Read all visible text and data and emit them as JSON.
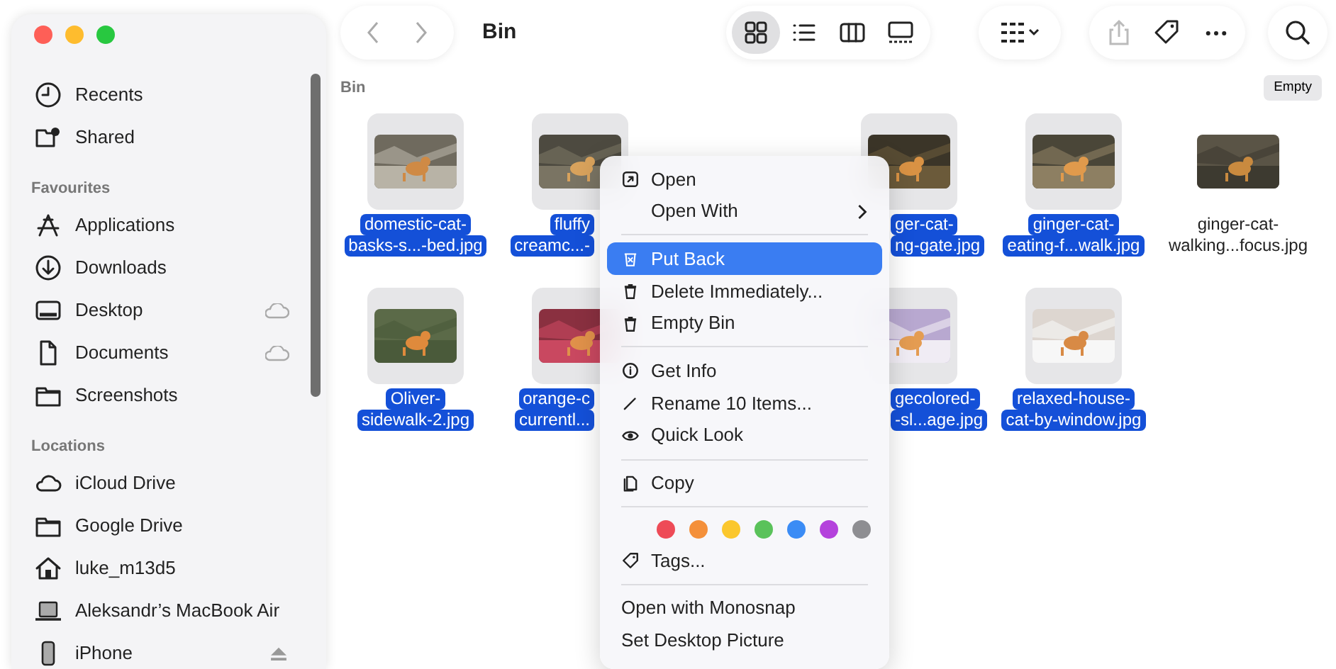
{
  "window": {
    "title": "Bin"
  },
  "sidebar": {
    "sections": [
      {
        "items": [
          {
            "label": "Recents"
          },
          {
            "label": "Shared"
          }
        ]
      },
      {
        "title": "Favourites",
        "items": [
          {
            "label": "Applications"
          },
          {
            "label": "Downloads"
          },
          {
            "label": "Desktop",
            "cloud": true
          },
          {
            "label": "Documents",
            "cloud": true
          },
          {
            "label": "Screenshots"
          }
        ]
      },
      {
        "title": "Locations",
        "items": [
          {
            "label": "iCloud Drive"
          },
          {
            "label": "Google Drive"
          },
          {
            "label": "luke_m13d5"
          },
          {
            "label": "Aleksandr’s MacBook Air"
          },
          {
            "label": "iPhone",
            "eject": true
          }
        ]
      }
    ]
  },
  "toolbar": {
    "views": [
      {
        "selected": true
      },
      {
        "selected": false
      },
      {
        "selected": false
      },
      {
        "selected": false
      }
    ]
  },
  "path_label": "Bin",
  "empty_button": "Empty",
  "files": [
    {
      "kind": "full",
      "name_lines": [
        "domestic-cat-",
        "basks-s...-bed.jpg"
      ],
      "selected": true
    },
    {
      "kind": "cut-right",
      "name_lines": [
        "fluffy",
        "creamc...-"
      ],
      "selected": true
    },
    {
      "kind": "cut-left",
      "name_lines": [
        "ger-cat-",
        "ng-gate.jpg"
      ],
      "selected": true
    },
    {
      "kind": "full",
      "name_lines": [
        "ginger-cat-",
        "eating-f...walk.jpg"
      ],
      "selected": true
    },
    {
      "kind": "full",
      "name_lines": [
        "ginger-cat-",
        "walking...focus.jpg"
      ],
      "selected": false
    },
    {
      "kind": "full",
      "name_lines": [
        "Oliver-",
        "sidewalk-2.jpg"
      ],
      "selected": true
    },
    {
      "kind": "cut-right",
      "name_lines": [
        "orange-c",
        "currentl..."
      ],
      "selected": true
    },
    {
      "kind": "cut-left",
      "name_lines": [
        "gecolored-",
        "-sl...age.jpg"
      ],
      "selected": true
    },
    {
      "kind": "full",
      "name_lines": [
        "relaxed-house-",
        "cat-by-window.jpg"
      ],
      "selected": true
    }
  ],
  "context_menu": [
    {
      "kind": "item",
      "label": "Open",
      "highlighted": false
    },
    {
      "kind": "item",
      "label": "Open With",
      "submenu": true,
      "highlighted": false
    },
    {
      "kind": "separator"
    },
    {
      "kind": "item",
      "label": "Put Back",
      "highlighted": true
    },
    {
      "kind": "item",
      "label": "Delete Immediately...",
      "highlighted": false
    },
    {
      "kind": "item",
      "label": "Empty Bin",
      "highlighted": false
    },
    {
      "kind": "separator"
    },
    {
      "kind": "item",
      "label": "Get Info",
      "highlighted": false
    },
    {
      "kind": "item",
      "label": "Rename 10 Items...",
      "highlighted": false
    },
    {
      "kind": "item",
      "label": "Quick Look",
      "highlighted": false
    },
    {
      "kind": "separator"
    },
    {
      "kind": "item",
      "label": "Copy",
      "highlighted": false
    },
    {
      "kind": "separator"
    },
    {
      "kind": "colors",
      "colors": [
        {
          "color": "#ee4b57"
        },
        {
          "color": "#f4903a"
        },
        {
          "color": "#fbc72d"
        },
        {
          "color": "#5ac25a"
        },
        {
          "color": "#3b8cf5"
        },
        {
          "color": "#b442dc"
        },
        {
          "color": "#8e8e92"
        }
      ]
    },
    {
      "kind": "item",
      "label": "Tags...",
      "highlighted": false
    },
    {
      "kind": "separator"
    },
    {
      "kind": "item",
      "label": "Open with Monosnap",
      "highlighted": false
    },
    {
      "kind": "item",
      "label": "Set Desktop Picture",
      "highlighted": false
    }
  ]
}
